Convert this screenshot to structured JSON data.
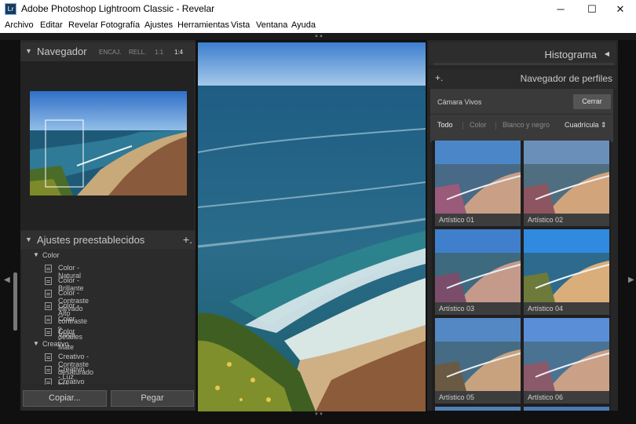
{
  "window": {
    "title": "Adobe Photoshop Lightroom Classic - Revelar",
    "app_icon_text": "Lr",
    "minimize": "─",
    "maximize": "☐",
    "close": "✕"
  },
  "menu": [
    "Archivo",
    "Editar",
    "Revelar",
    "Fotografía",
    "Ajustes",
    "Herramientas",
    "Vista",
    "Ventana",
    "Ayuda"
  ],
  "navigator": {
    "title": "Navegador",
    "zoom_options": [
      "ENCAJ.",
      "RELL.",
      "1:1",
      "1:4"
    ],
    "active_zoom": "1:4"
  },
  "presets": {
    "title": "Ajustes preestablecidos",
    "add_symbol": "+.",
    "groups": [
      {
        "name": "Color",
        "items": [
          "Color - Natural",
          "Color - Brillante",
          "Color - Contraste elevado",
          "Color - Alto contraste y detalles",
          "Color - Vivos",
          "Color - Mate"
        ]
      },
      {
        "name": "Creativo",
        "items": [
          "Creativo - Contraste desaturado",
          "Creativo - Luz fría",
          "Creativo - Turquesa y rojo"
        ]
      }
    ]
  },
  "buttons": {
    "copy": "Copiar...",
    "paste": "Pegar"
  },
  "histogram": {
    "title": "Histograma"
  },
  "profile_browser": {
    "title": "Navegador de perfiles",
    "group_name": "Cámara Vivos",
    "close_label": "Cerrar",
    "filters": [
      "Todo",
      "Color",
      "Blanco y negro"
    ],
    "active_filter": "Todo",
    "view_mode": "Cuadrícula",
    "profiles": [
      "Artístico 01",
      "Artístico 02",
      "Artístico 03",
      "Artístico 04",
      "Artístico 05",
      "Artístico 06"
    ]
  },
  "colors": {
    "panel_bg": "#282828",
    "header_bg": "#303030",
    "accent_text": "#c8c8c8",
    "close_button": "#555555"
  }
}
